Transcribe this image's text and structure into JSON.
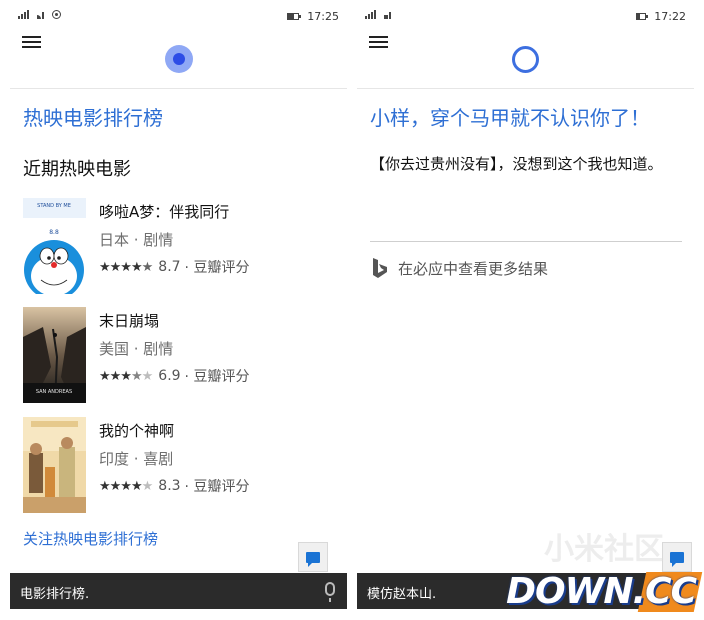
{
  "left_screen": {
    "status": {
      "time": "17:25"
    },
    "bottom_query": "电影排行榜.",
    "card_title": "热映电影排行榜",
    "section_title": "近期热映电影",
    "movies": [
      {
        "title": "哆啦A梦：伴我同行",
        "meta": "日本 · 剧情",
        "rating": 4.5,
        "score": "8.7",
        "source": "· 豆瓣评分",
        "poster_caption": "STAND BY ME"
      },
      {
        "title": "末日崩塌",
        "meta": "美国 · 剧情",
        "rating": 3.5,
        "score": "6.9",
        "source": "· 豆瓣评分",
        "poster_caption": "SAN ANDREAS"
      },
      {
        "title": "我的个神啊",
        "meta": "印度 · 喜剧",
        "rating": 4,
        "score": "8.3",
        "source": "· 豆瓣评分",
        "poster_caption": ""
      }
    ],
    "follow_link": "关注热映电影排行榜",
    "icons": {
      "menu": "hamburger-icon",
      "cortana": "cortana-orb-icon",
      "feedback": "feedback-icon",
      "mic": "microphone-icon"
    }
  },
  "right_screen": {
    "status": {
      "time": "17:22"
    },
    "bottom_query": "模仿赵本山.",
    "reply_title": "小样，穿个马甲就不认识你了！",
    "reply_body": "【你去过贵州没有】，没想到这个我也知道。",
    "bing_link": "在必应中查看更多结果",
    "icons": {
      "menu": "hamburger-icon",
      "cortana": "cortana-ring-icon",
      "bing": "bing-icon",
      "feedback": "feedback-icon"
    }
  },
  "watermark": {
    "text": "DOWN.CC",
    "ghost": "小米社区"
  },
  "colors": {
    "accent": "#2e6fd4",
    "bar": "#2b2b2b",
    "orb": "#2c4ce6",
    "star": "#333333"
  }
}
